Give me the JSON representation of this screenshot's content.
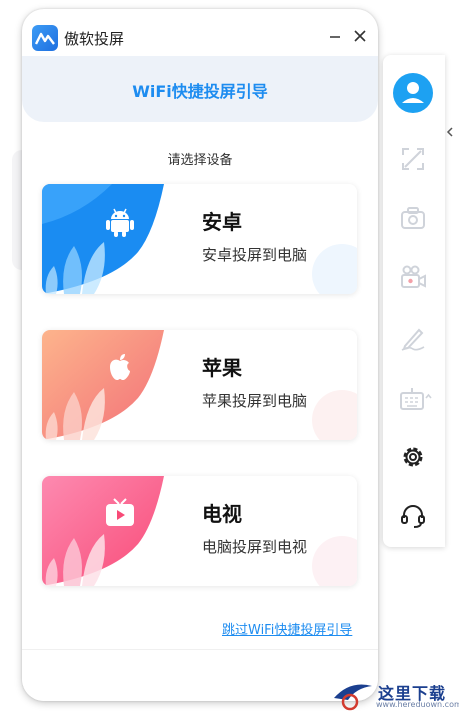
{
  "app": {
    "title": "傲软投屏"
  },
  "banner": {
    "title": "WiFi快捷投屏引导"
  },
  "prompt": "请选择设备",
  "devices": [
    {
      "name": "安卓",
      "description": "安卓投屏到电脑",
      "icon": "android-icon",
      "accent": "#1a8cf2"
    },
    {
      "name": "苹果",
      "description": "苹果投屏到电脑",
      "icon": "apple-icon",
      "accent": "#f5816e"
    },
    {
      "name": "电视",
      "description": "电脑投屏到电视",
      "icon": "tv-icon",
      "accent": "#f9507a"
    }
  ],
  "skip_link": "跳过WiFi快捷投屏引导",
  "sidebar": {
    "items": [
      {
        "icon": "user-avatar-icon",
        "enabled": true
      },
      {
        "icon": "fullscreen-icon",
        "enabled": false
      },
      {
        "icon": "camera-icon",
        "enabled": false
      },
      {
        "icon": "video-record-icon",
        "enabled": false
      },
      {
        "icon": "pen-icon",
        "enabled": false
      },
      {
        "icon": "keyboard-icon",
        "enabled": false
      },
      {
        "icon": "settings-gear-icon",
        "enabled": true
      },
      {
        "icon": "headset-support-icon",
        "enabled": true
      }
    ]
  },
  "watermark": {
    "text": "这里下载",
    "url": "www.hereduown.com"
  },
  "colors": {
    "brand_blue": "#1d8cf0",
    "banner_bg": "#edf2f9",
    "watermark": "#1b3f8f"
  }
}
